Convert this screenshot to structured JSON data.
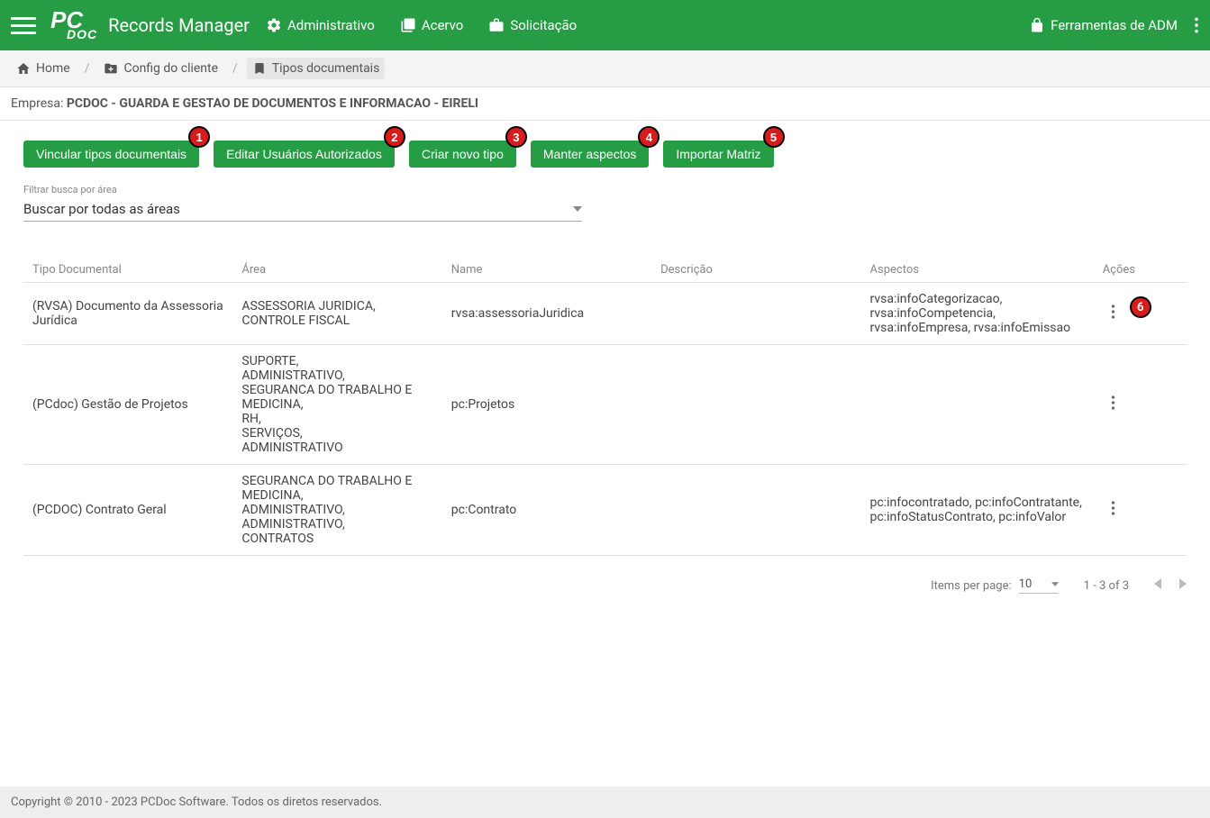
{
  "header": {
    "app_title": "Records Manager",
    "nav": {
      "admin": "Administrativo",
      "acervo": "Acervo",
      "solicitacao": "Solicitação"
    },
    "adm_tools": "Ferramentas de ADM"
  },
  "breadcrumbs": {
    "home": "Home",
    "config": "Config do cliente",
    "tipos": "Tipos documentais"
  },
  "company": {
    "label": "Empresa: ",
    "value": "PCDOC - GUARDA E GESTAO DE DOCUMENTOS E INFORMACAO - EIRELI"
  },
  "buttons": {
    "vincular": "Vincular tipos documentais",
    "editar_usuarios": "Editar Usuários Autorizados",
    "criar_tipo": "Criar novo tipo",
    "manter_aspectos": "Manter aspectos",
    "importar_matriz": "Importar Matriz"
  },
  "annotations": {
    "b1": "1",
    "b2": "2",
    "b3": "3",
    "b4": "4",
    "b5": "5",
    "b6": "6"
  },
  "filter": {
    "label": "Filtrar busca por área",
    "selected": "Buscar por todas as áreas"
  },
  "table": {
    "headers": {
      "tipo": "Tipo Documental",
      "area": "Área",
      "name": "Name",
      "desc": "Descrição",
      "aspectos": "Aspectos",
      "acoes": "Ações"
    },
    "rows": [
      {
        "tipo": "(RVSA) Documento da Assessoria Jurídica",
        "area": "ASSESSORIA JURIDICA,\nCONTROLE FISCAL",
        "name": "rvsa:assessoriaJuridica",
        "desc": "",
        "aspectos": "rvsa:infoCategorizacao, rvsa:infoCompetencia, rvsa:infoEmpresa, rvsa:infoEmissao"
      },
      {
        "tipo": "(PCdoc) Gestão de Projetos",
        "area": "SUPORTE,\nADMINISTRATIVO,\nSEGURANCA DO TRABALHO E MEDICINA,\nRH,\nSERVIÇOS,\nADMINISTRATIVO",
        "name": "pc:Projetos",
        "desc": "",
        "aspectos": ""
      },
      {
        "tipo": "(PCDOC) Contrato Geral",
        "area": "SEGURANCA DO TRABALHO E MEDICINA,\nADMINISTRATIVO,\nADMINISTRATIVO,\nCONTRATOS",
        "name": "pc:Contrato",
        "desc": "",
        "aspectos": "pc:infocontratado, pc:infoContratante, pc:infoStatusContrato, pc:infoValor"
      }
    ]
  },
  "pagination": {
    "items_per_label": "Items per page:",
    "items_per_value": "10",
    "range": "1 - 3 of 3"
  },
  "footer": {
    "text": "Copyright © 2010 - 2023 PCDoc Software. Todos os diretos reservados."
  }
}
